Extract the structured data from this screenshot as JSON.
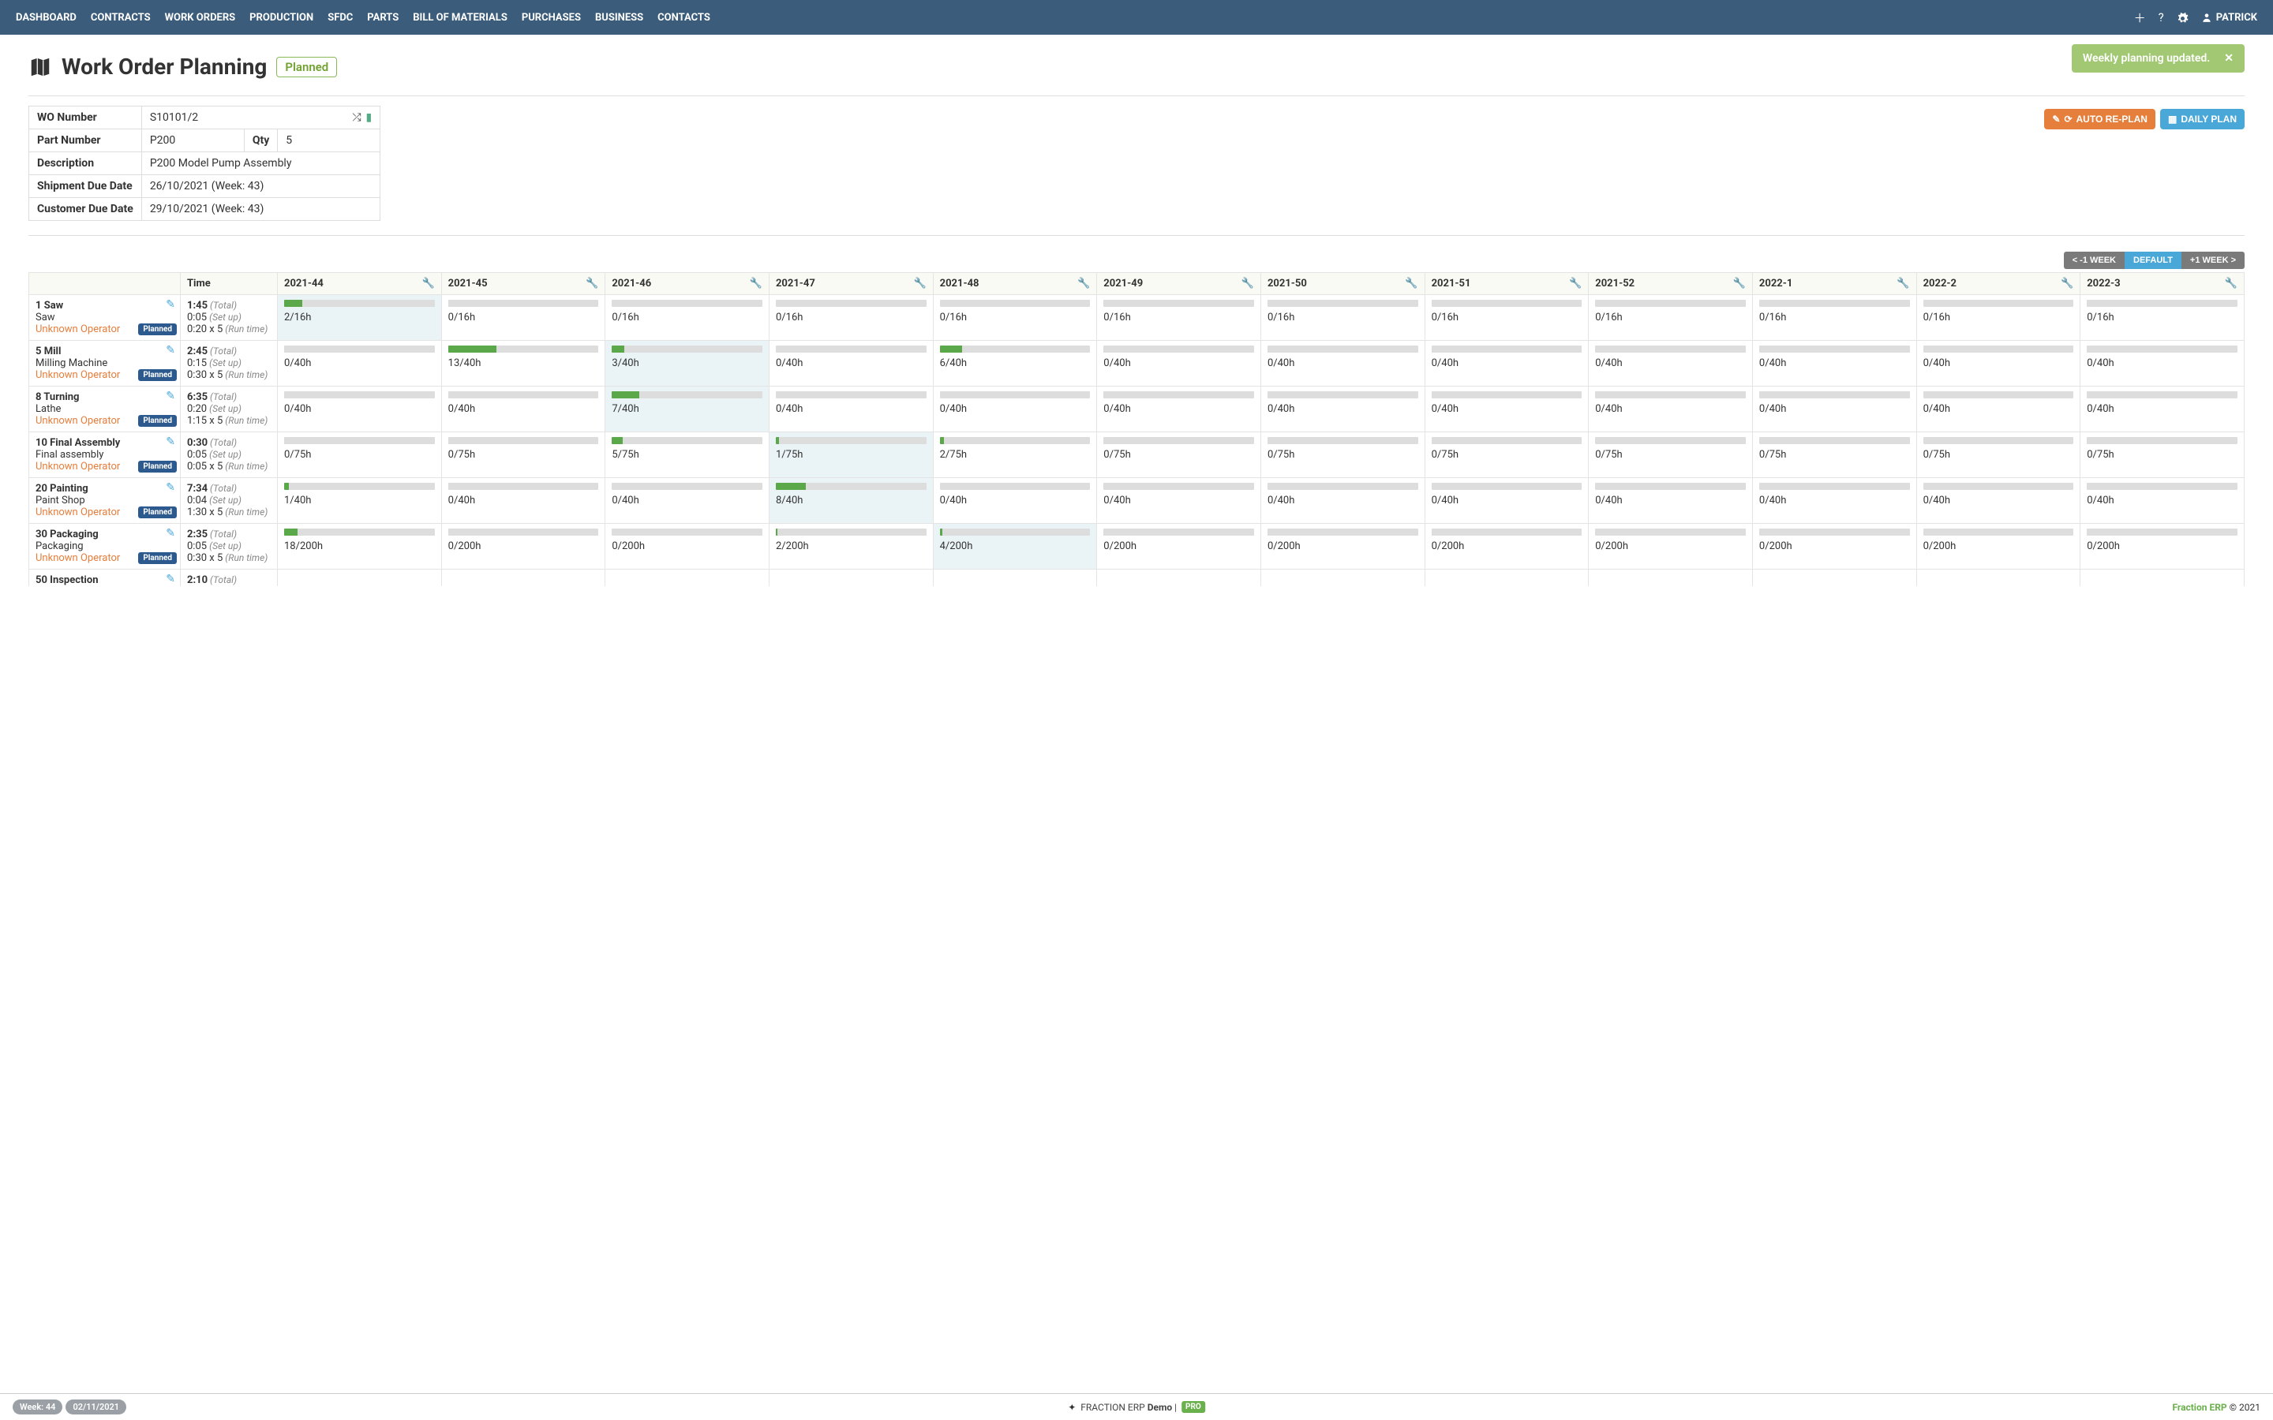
{
  "nav": {
    "items": [
      "DASHBOARD",
      "CONTRACTS",
      "WORK ORDERS",
      "PRODUCTION",
      "SFDC",
      "PARTS",
      "BILL OF MATERIALS",
      "PURCHASES",
      "BUSINESS",
      "CONTACTS"
    ],
    "user": "PATRICK"
  },
  "page": {
    "title": "Work Order Planning",
    "status": "Planned"
  },
  "toast": {
    "message": "Weekly planning updated.",
    "close": "✕"
  },
  "info": {
    "wo_number_label": "WO Number",
    "wo_number": "S10101/2",
    "part_number_label": "Part Number",
    "part_number": "P200",
    "qty_label": "Qty",
    "qty": "5",
    "description_label": "Description",
    "description": "P200 Model Pump Assembly",
    "ship_label": "Shipment Due Date",
    "ship": "26/10/2021 (Week: 43)",
    "cust_label": "Customer Due Date",
    "cust": "29/10/2021 (Week: 43)"
  },
  "buttons": {
    "autoreplan": "AUTO RE-PLAN",
    "dailyplan": "DAILY PLAN"
  },
  "week_nav": {
    "prev": "< -1 WEEK",
    "default": "DEFAULT",
    "next": "+1 WEEK >"
  },
  "columns": {
    "time_header": "Time",
    "weeks": [
      "2021-44",
      "2021-45",
      "2021-46",
      "2021-47",
      "2021-48",
      "2021-49",
      "2021-50",
      "2021-51",
      "2021-52",
      "2022-1",
      "2022-2",
      "2022-3"
    ]
  },
  "labels": {
    "total": "(Total)",
    "setup": "(Set up)",
    "runtime": "(Run time)",
    "planned": "Planned",
    "unknown_operator": "Unknown Operator"
  },
  "operations": [
    {
      "id": "1 Saw",
      "machine": "Saw",
      "time": {
        "total": "1:45",
        "setup": "0:05",
        "run": "0:20 x 5"
      },
      "highlight_col": 0,
      "cells": [
        {
          "v": "2/16h",
          "p": 12
        },
        {
          "v": "0/16h",
          "p": 0
        },
        {
          "v": "0/16h",
          "p": 0
        },
        {
          "v": "0/16h",
          "p": 0
        },
        {
          "v": "0/16h",
          "p": 0
        },
        {
          "v": "0/16h",
          "p": 0
        },
        {
          "v": "0/16h",
          "p": 0
        },
        {
          "v": "0/16h",
          "p": 0
        },
        {
          "v": "0/16h",
          "p": 0
        },
        {
          "v": "0/16h",
          "p": 0
        },
        {
          "v": "0/16h",
          "p": 0
        },
        {
          "v": "0/16h",
          "p": 0
        }
      ]
    },
    {
      "id": "5 Mill",
      "machine": "Milling Machine",
      "time": {
        "total": "2:45",
        "setup": "0:15",
        "run": "0:30 x 5"
      },
      "highlight_col": 2,
      "cells": [
        {
          "v": "0/40h",
          "p": 0
        },
        {
          "v": "13/40h",
          "p": 32
        },
        {
          "v": "3/40h",
          "p": 8
        },
        {
          "v": "0/40h",
          "p": 0
        },
        {
          "v": "6/40h",
          "p": 15
        },
        {
          "v": "0/40h",
          "p": 0
        },
        {
          "v": "0/40h",
          "p": 0
        },
        {
          "v": "0/40h",
          "p": 0
        },
        {
          "v": "0/40h",
          "p": 0
        },
        {
          "v": "0/40h",
          "p": 0
        },
        {
          "v": "0/40h",
          "p": 0
        },
        {
          "v": "0/40h",
          "p": 0
        }
      ]
    },
    {
      "id": "8 Turning",
      "machine": "Lathe",
      "time": {
        "total": "6:35",
        "setup": "0:20",
        "run": "1:15 x 5"
      },
      "highlight_col": 2,
      "cells": [
        {
          "v": "0/40h",
          "p": 0
        },
        {
          "v": "0/40h",
          "p": 0
        },
        {
          "v": "7/40h",
          "p": 18
        },
        {
          "v": "0/40h",
          "p": 0
        },
        {
          "v": "0/40h",
          "p": 0
        },
        {
          "v": "0/40h",
          "p": 0
        },
        {
          "v": "0/40h",
          "p": 0
        },
        {
          "v": "0/40h",
          "p": 0
        },
        {
          "v": "0/40h",
          "p": 0
        },
        {
          "v": "0/40h",
          "p": 0
        },
        {
          "v": "0/40h",
          "p": 0
        },
        {
          "v": "0/40h",
          "p": 0
        }
      ]
    },
    {
      "id": "10 Final Assembly",
      "machine": "Final assembly",
      "time": {
        "total": "0:30",
        "setup": "0:05",
        "run": "0:05 x 5"
      },
      "highlight_col": 3,
      "cells": [
        {
          "v": "0/75h",
          "p": 0
        },
        {
          "v": "0/75h",
          "p": 0
        },
        {
          "v": "5/75h",
          "p": 7
        },
        {
          "v": "1/75h",
          "p": 2
        },
        {
          "v": "2/75h",
          "p": 3
        },
        {
          "v": "0/75h",
          "p": 0
        },
        {
          "v": "0/75h",
          "p": 0
        },
        {
          "v": "0/75h",
          "p": 0
        },
        {
          "v": "0/75h",
          "p": 0
        },
        {
          "v": "0/75h",
          "p": 0
        },
        {
          "v": "0/75h",
          "p": 0
        },
        {
          "v": "0/75h",
          "p": 0
        }
      ]
    },
    {
      "id": "20 Painting",
      "machine": "Paint Shop",
      "time": {
        "total": "7:34",
        "setup": "0:04",
        "run": "1:30 x 5"
      },
      "highlight_col": 3,
      "cells": [
        {
          "v": "1/40h",
          "p": 3
        },
        {
          "v": "0/40h",
          "p": 0
        },
        {
          "v": "0/40h",
          "p": 0
        },
        {
          "v": "8/40h",
          "p": 20
        },
        {
          "v": "0/40h",
          "p": 0
        },
        {
          "v": "0/40h",
          "p": 0
        },
        {
          "v": "0/40h",
          "p": 0
        },
        {
          "v": "0/40h",
          "p": 0
        },
        {
          "v": "0/40h",
          "p": 0
        },
        {
          "v": "0/40h",
          "p": 0
        },
        {
          "v": "0/40h",
          "p": 0
        },
        {
          "v": "0/40h",
          "p": 0
        }
      ]
    },
    {
      "id": "30 Packaging",
      "machine": "Packaging",
      "time": {
        "total": "2:35",
        "setup": "0:05",
        "run": "0:30 x 5"
      },
      "highlight_col": 4,
      "cells": [
        {
          "v": "18/200h",
          "p": 9
        },
        {
          "v": "0/200h",
          "p": 0
        },
        {
          "v": "0/200h",
          "p": 0
        },
        {
          "v": "2/200h",
          "p": 1
        },
        {
          "v": "4/200h",
          "p": 2
        },
        {
          "v": "0/200h",
          "p": 0
        },
        {
          "v": "0/200h",
          "p": 0
        },
        {
          "v": "0/200h",
          "p": 0
        },
        {
          "v": "0/200h",
          "p": 0
        },
        {
          "v": "0/200h",
          "p": 0
        },
        {
          "v": "0/200h",
          "p": 0
        },
        {
          "v": "0/200h",
          "p": 0
        }
      ]
    }
  ],
  "cutoff": {
    "id": "50 Inspection",
    "total": "2:10"
  },
  "footer": {
    "week": "Week: 44",
    "date": "02/11/2021",
    "brand_pre": "FRACTION ERP ",
    "brand_bold": "Demo",
    "pro": "PRO",
    "right_brand": "Fraction ERP",
    "copyright": " © 2021"
  }
}
